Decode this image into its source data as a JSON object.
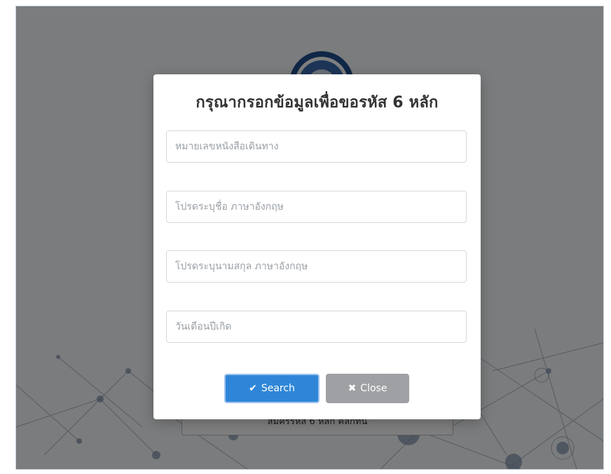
{
  "background": {
    "button_label": "สมัครรหัส 6 หลัก คลิกที่นี่"
  },
  "modal": {
    "title": "กรุณากรอกข้อมูลเพื่อขอรหัส 6 หลัก",
    "fields": [
      {
        "placeholder": "หมายเลขหนังสือเดินทาง",
        "value": ""
      },
      {
        "placeholder": "โปรดระบุชื่อ ภาษาอังกฤษ",
        "value": ""
      },
      {
        "placeholder": "โปรดระบุนามสกุล ภาษาอังกฤษ",
        "value": ""
      },
      {
        "placeholder": "วันเดือนปีเกิด",
        "value": ""
      }
    ],
    "search_label": "Search",
    "close_label": "Close",
    "search_icon": "check-icon",
    "close_icon": "close-icon"
  },
  "colors": {
    "primary": "#2f86d8",
    "secondary": "#9ea0a3",
    "overlay": "rgba(0,0,0,0.5)"
  }
}
